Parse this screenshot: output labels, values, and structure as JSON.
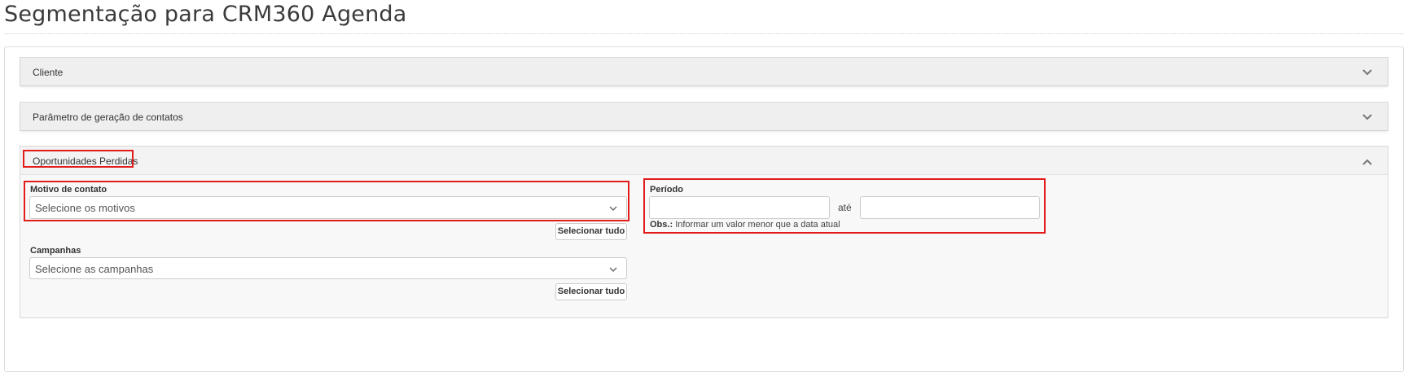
{
  "page": {
    "title": "Segmentação para CRM360 Agenda"
  },
  "panels": [
    {
      "label": "Cliente",
      "state": "collapsed",
      "icon": "chevron-down-icon"
    },
    {
      "label": "Parâmetro de geração de contatos",
      "state": "collapsed",
      "icon": "chevron-down-icon"
    },
    {
      "label": "Oportunidades Perdidas",
      "state": "expanded",
      "icon": "chevron-up-icon"
    }
  ],
  "oportunidades": {
    "motivo": {
      "label": "Motivo de contato",
      "placeholder": "Selecione os motivos",
      "select_all": "Selecionar tudo"
    },
    "campanhas": {
      "label": "Campanhas",
      "placeholder": "Selecione as campanhas",
      "select_all": "Selecionar tudo"
    },
    "periodo": {
      "label": "Período",
      "start_value": "",
      "separator": "até",
      "end_value": "",
      "obs_label": "Obs.:",
      "obs_text": "Informar um valor menor que a data atual"
    }
  },
  "colors": {
    "highlight": "#e21b1b",
    "panel_bg": "#efefef",
    "text": "#333333"
  }
}
